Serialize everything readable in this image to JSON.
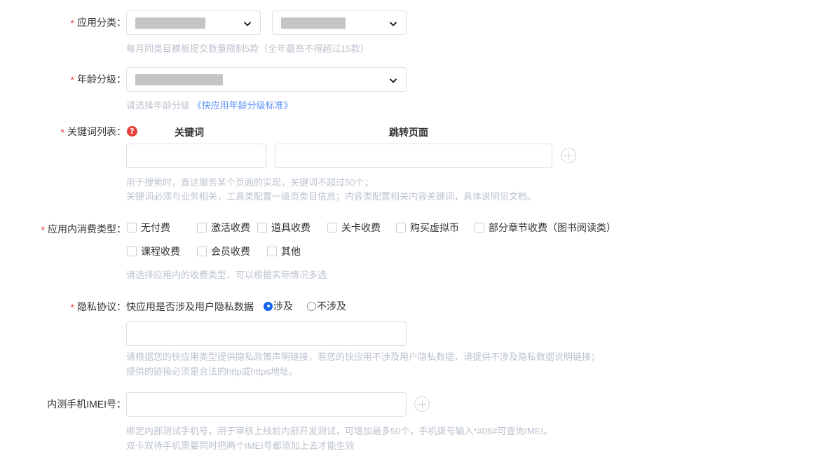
{
  "form": {
    "rows": {
      "app_category": {
        "label": "应用分类：",
        "required": true,
        "select_primary_value": "",
        "select_secondary_value": "",
        "hint": "每月同类目模板提交数量限制5款（全年最高不得超过15款）"
      },
      "age_rating": {
        "label": "年龄分级：",
        "required": true,
        "select_value": "",
        "hint_prefix": "请选择年龄分级 ",
        "hint_link": "《快应用年龄分级标准》"
      },
      "keyword_list": {
        "label": "关键词列表：",
        "required": true,
        "help_icon": "question-mark-icon",
        "help_glyph": "?",
        "column_keyword": "关键词",
        "column_jump_page": "跳转页面",
        "keyword_value": "",
        "keyword_placeholder": "",
        "jump_page_value": "",
        "jump_page_placeholder": "",
        "add_icon": "plus-circle-icon",
        "hint_line1": "用于搜索时，直达服务某个页面的实现，关键词不超过50个；",
        "hint_line2": "关键词必须与业务相关，工具类配置一级页类目信息；内容类配置相关内容关键词，具体说明见文档。"
      },
      "in_app_purchase": {
        "label": "应用内消费类型：",
        "required": true,
        "options_row1": [
          {
            "label": "无付费",
            "checked": false
          },
          {
            "label": "激活收费",
            "checked": false
          },
          {
            "label": "道具收费",
            "checked": false
          },
          {
            "label": "关卡收费",
            "checked": false
          },
          {
            "label": "购买虚拟币",
            "checked": false
          },
          {
            "label": "部分章节收费（图书阅读类）",
            "checked": false
          }
        ],
        "options_row2": [
          {
            "label": "课程收费",
            "checked": false
          },
          {
            "label": "会员收费",
            "checked": false
          },
          {
            "label": "其他",
            "checked": false
          }
        ],
        "hint": "请选择应用内的收费类型，可以根据实际情况多选"
      },
      "privacy_policy": {
        "label": "隐私协议：",
        "required": true,
        "question": "快应用是否涉及用户隐私数据",
        "radios": [
          {
            "label": "涉及",
            "selected": true
          },
          {
            "label": "不涉及",
            "selected": false
          }
        ],
        "input_value": "",
        "input_placeholder": "",
        "hint_line1": "请根据您的快应用类型提供隐私政策声明链接，若您的快应用不涉及用户隐私数据，请提供不涉及隐私数据说明链接；",
        "hint_line2": "提供的链接必须是合法的http或https地址。"
      },
      "imei": {
        "label": "内测手机IMEI号：",
        "required": false,
        "input_value": "",
        "input_placeholder": "",
        "add_icon": "plus-circle-icon",
        "hint_line1": "绑定内部测试手机号，用于审核上线前内部开发测试，可增加最多50个，手机拨号输入*#06#可查询IMEI。",
        "hint_line2": "双卡双待手机需要同时把两个IMEI号都添加上去才能生效"
      }
    }
  },
  "colors": {
    "required_asterisk": "#e8413c",
    "hint_text": "#bcc3ce",
    "link_blue": "#5b8ff9",
    "radio_selected": "#1464f0",
    "border": "#dcdfe6",
    "redaction": "#c4c4c4",
    "text": "#333333"
  }
}
